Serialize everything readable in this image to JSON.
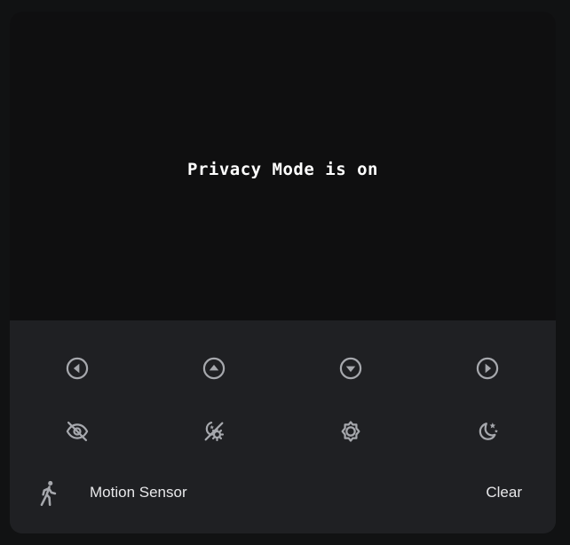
{
  "camera": {
    "status_text": "Privacy Mode is on"
  },
  "ptz_controls": [
    {
      "name": "pan-left",
      "icon": "chevron-left-circle-icon"
    },
    {
      "name": "tilt-up",
      "icon": "chevron-up-circle-icon"
    },
    {
      "name": "tilt-down",
      "icon": "chevron-down-circle-icon"
    },
    {
      "name": "pan-right",
      "icon": "chevron-right-circle-icon"
    }
  ],
  "mode_controls": [
    {
      "name": "privacy-mode",
      "icon": "eye-off-icon"
    },
    {
      "name": "auto-day-night",
      "icon": "theme-light-dark-icon"
    },
    {
      "name": "day-mode",
      "icon": "brightness-icon"
    },
    {
      "name": "night-mode",
      "icon": "moon-stars-icon"
    }
  ],
  "motion_sensor": {
    "icon": "walk-icon",
    "label": "Motion Sensor",
    "state": "Clear"
  },
  "colors": {
    "background": "#111213",
    "card": "#1f2023",
    "viewer": "#0f0f10",
    "icon": "#a6a8ad",
    "text": "#e8e8ea"
  }
}
